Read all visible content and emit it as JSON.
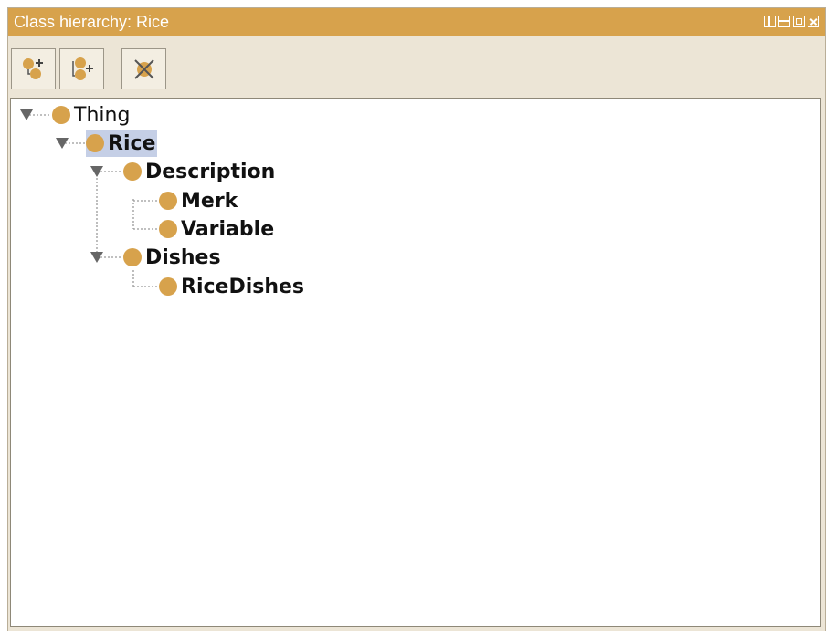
{
  "window": {
    "title": "Class hierarchy: Rice"
  },
  "toolbar": {
    "buttons": [
      {
        "name": "add-subclass",
        "icon": "add-subclass-icon"
      },
      {
        "name": "add-sibling",
        "icon": "add-sibling-icon"
      },
      {
        "name": "delete-class",
        "icon": "delete-class-icon"
      }
    ]
  },
  "tree": {
    "nodes": [
      {
        "label": "Thing",
        "depth": 0,
        "expanded": true
      },
      {
        "label": "Rice",
        "depth": 1,
        "expanded": true,
        "selected": true
      },
      {
        "label": "Description",
        "depth": 2,
        "expanded": true
      },
      {
        "label": "Merk",
        "depth": 3
      },
      {
        "label": "Variable",
        "depth": 3
      },
      {
        "label": "Dishes",
        "depth": 2,
        "expanded": true
      },
      {
        "label": "RiceDishes",
        "depth": 3
      }
    ]
  },
  "colors": {
    "accent": "#d7a24c",
    "panel": "#ece5d6",
    "selection": "#c5cfe6"
  }
}
